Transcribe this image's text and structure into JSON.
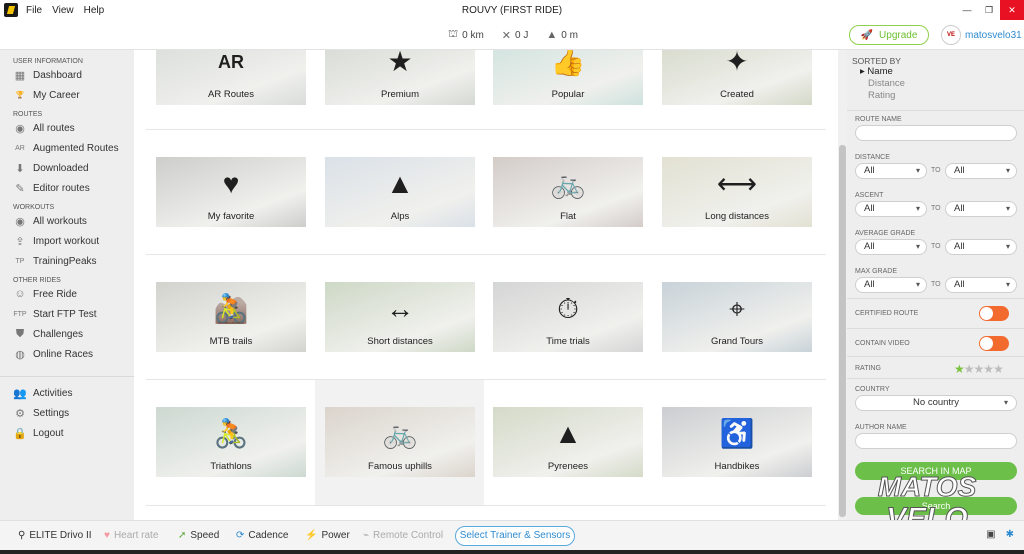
{
  "window": {
    "title": "ROUVY (FIRST RIDE)",
    "menu": [
      "File",
      "View",
      "Help"
    ]
  },
  "stats": {
    "distance": "0 km",
    "energy": "0 J",
    "elevation": "0 m"
  },
  "header": {
    "upgrade_label": "Upgrade",
    "username": "matosvelo31"
  },
  "sidebar": {
    "sections": [
      {
        "title": "USER INFORMATION",
        "items": [
          {
            "label": "Dashboard",
            "icon": "dashboard-icon"
          },
          {
            "label": "My Career",
            "icon": "trophy-icon"
          }
        ]
      },
      {
        "title": "ROUTES",
        "items": [
          {
            "label": "All routes",
            "icon": "eye-icon"
          },
          {
            "label": "Augmented Routes",
            "icon": "ar-rider-icon"
          },
          {
            "label": "Downloaded",
            "icon": "download-icon"
          },
          {
            "label": "Editor routes",
            "icon": "edit-icon"
          }
        ]
      },
      {
        "title": "WORKOUTS",
        "items": [
          {
            "label": "All workouts",
            "icon": "eye-icon"
          },
          {
            "label": "Import workout",
            "icon": "import-icon"
          },
          {
            "label": "TrainingPeaks",
            "icon": "trainingpeaks-icon"
          }
        ]
      },
      {
        "title": "OTHER RIDES",
        "items": [
          {
            "label": "Free Ride",
            "icon": "smiley-icon"
          },
          {
            "label": "Start FTP Test",
            "icon": "ftp-icon"
          },
          {
            "label": "Challenges",
            "icon": "shield-icon"
          },
          {
            "label": "Online Races",
            "icon": "globe-icon"
          }
        ]
      }
    ],
    "bottom_items": [
      {
        "label": "Activities",
        "icon": "people-icon"
      },
      {
        "label": "Settings",
        "icon": "gear-icon"
      },
      {
        "label": "Logout",
        "icon": "lock-icon"
      }
    ]
  },
  "tiles": [
    {
      "label": "AR Routes",
      "icon": "ar-rider-icon",
      "glyph": "AR",
      "bg": "#9aa39b"
    },
    {
      "label": "Premium",
      "icon": "star-icon",
      "glyph": "★",
      "bg": "#8f9a8a"
    },
    {
      "label": "Popular",
      "icon": "thumbs-up-icon",
      "glyph": "👍",
      "bg": "#7fb3a8"
    },
    {
      "label": "Created",
      "icon": "magic-wand-icon",
      "glyph": "✦",
      "bg": "#8e9a6e"
    },
    {
      "label": "My favorite",
      "icon": "heart-icon",
      "glyph": "♥",
      "bg": "#7c7f79"
    },
    {
      "label": "Alps",
      "icon": "mountain-icon",
      "glyph": "▲",
      "bg": "#9fb0c2"
    },
    {
      "label": "Flat",
      "icon": "bicycle-flat-icon",
      "glyph": "🚲",
      "bg": "#8c7a72"
    },
    {
      "label": "Long distances",
      "icon": "long-distance-icon",
      "glyph": "⟷",
      "bg": "#b2b08a"
    },
    {
      "label": "MTB trails",
      "icon": "mtb-icon",
      "glyph": "🚵",
      "bg": "#8a8a7e"
    },
    {
      "label": "Short distances",
      "icon": "short-distance-icon",
      "glyph": "↔",
      "bg": "#7e9a6a"
    },
    {
      "label": "Time trials",
      "icon": "stopwatch-icon",
      "glyph": "⏱",
      "bg": "#8e9190"
    },
    {
      "label": "Grand Tours",
      "icon": "map-pin-icon",
      "glyph": "⌖",
      "bg": "#6f8a9a"
    },
    {
      "label": "Triathlons",
      "icon": "triathlon-icon",
      "glyph": "🚴",
      "bg": "#7a9a86"
    },
    {
      "label": "Famous uphills",
      "icon": "uphill-icon",
      "glyph": "🚲",
      "bg": "#a08e7a"
    },
    {
      "label": "Pyrenees",
      "icon": "mountain-icon",
      "glyph": "▲",
      "bg": "#8f9e6e"
    },
    {
      "label": "Handbikes",
      "icon": "handbike-icon",
      "glyph": "♿",
      "bg": "#7a7d86"
    }
  ],
  "filters": {
    "sorted_by": "SORTED BY",
    "sort_options": [
      "Name",
      "Distance",
      "Rating"
    ],
    "route_name_label": "ROUTE NAME",
    "distance_label": "DISTANCE",
    "ascent_label": "ASCENT",
    "avg_grade_label": "AVERAGE GRADE",
    "max_grade_label": "MAX GRADE",
    "all": "All",
    "to": "TO",
    "certified_label": "CERTIFIED ROUTE",
    "video_label": "CONTAIN VIDEO",
    "rating_label": "RATING",
    "rating_value": 1,
    "country_label": "COUNTRY",
    "country_value": "No country",
    "author_label": "AUTHOR NAME",
    "search_map": "SEARCH IN MAP",
    "search": "Search",
    "toggle_color": "#f26a2e",
    "green": "#6cc04a"
  },
  "bottom": {
    "trainer": "ELITE Drivo II",
    "heart": "Heart rate",
    "speed": "Speed",
    "cadence": "Cadence",
    "power": "Power",
    "remote": "Remote Control",
    "select_trainer": "Select Trainer & Sensors"
  },
  "watermark": "MATOS VELO"
}
